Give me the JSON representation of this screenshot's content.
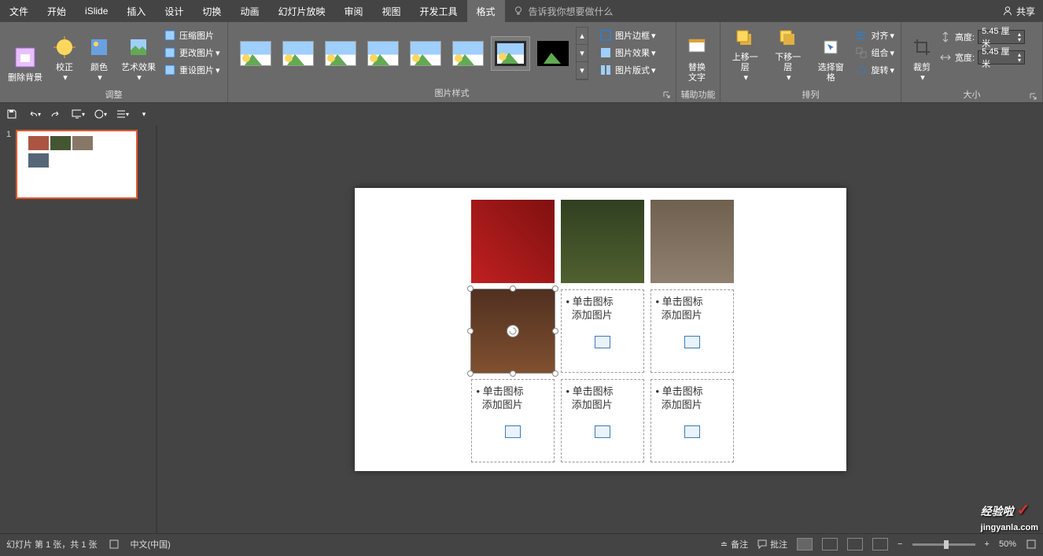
{
  "tabs": {
    "file": "文件",
    "home": "开始",
    "islide": "iSlide",
    "insert": "插入",
    "design": "设计",
    "transition": "切换",
    "animation": "动画",
    "slideshow": "幻灯片放映",
    "review": "审阅",
    "view": "视图",
    "dev": "开发工具",
    "format": "格式"
  },
  "tellme_placeholder": "告诉我你想要做什么",
  "share": "共享",
  "ribbon": {
    "adjust": {
      "remove_bg": "删除背景",
      "corrections": "校正",
      "color": "颜色",
      "artistic": "艺术效果",
      "compress": "压缩图片",
      "change": "更改图片",
      "reset": "重设图片",
      "group": "调整"
    },
    "styles": {
      "border": "图片边框",
      "effects": "图片效果",
      "layout": "图片版式",
      "group": "图片样式"
    },
    "acc": {
      "alttext": "替换\n文字",
      "group": "辅助功能"
    },
    "arrange": {
      "forward": "上移一层",
      "backward": "下移一层",
      "selection": "选择窗格",
      "align": "对齐",
      "group_btn": "组合",
      "rotate": "旋转",
      "group": "排列"
    },
    "size": {
      "crop": "裁剪",
      "height_lbl": "高度:",
      "width_lbl": "宽度:",
      "height_val": "5.45 厘米",
      "width_val": "5.45 厘米",
      "group": "大小"
    }
  },
  "placeholder": {
    "line1": "• 单击图标",
    "line2": "添加图片"
  },
  "status": {
    "slide": "幻灯片 第 1 张，共 1 张",
    "lang": "中文(中国)",
    "notes": "备注",
    "comments": "批注",
    "zoom": "50%"
  },
  "thumb_num": "1",
  "watermark": {
    "text": "经验啦",
    "url": "jingyanla.com",
    "check": "✓"
  }
}
